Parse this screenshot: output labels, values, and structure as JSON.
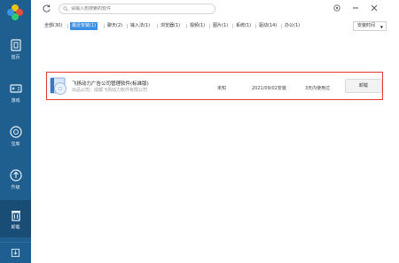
{
  "search": {
    "placeholder": "请输入想搜索的软件"
  },
  "sidebar": {
    "items": [
      {
        "label": "首页"
      },
      {
        "label": "游戏"
      },
      {
        "label": "宝库"
      },
      {
        "label": "升级"
      },
      {
        "label": "卸载"
      }
    ]
  },
  "tabs": [
    {
      "label": "全部(30)"
    },
    {
      "label": "最近安装(1)"
    },
    {
      "label": "聊天(2)"
    },
    {
      "label": "输入法(1)"
    },
    {
      "label": "浏览器(1)"
    },
    {
      "label": "视频(1)"
    },
    {
      "label": "图片(1)"
    },
    {
      "label": "系统(1)"
    },
    {
      "label": "驱动(14)"
    },
    {
      "label": "办公(1)"
    }
  ],
  "sort": {
    "value": "安装时间"
  },
  "software_list": [
    {
      "name": "飞扬动力广告公司管理软件(标准版)",
      "publisher": "出品公司：成都飞扬动力软件有限公司",
      "size": "未知",
      "install_date": "2021/09/02安装",
      "usage": "3天内使用过",
      "action": "卸载"
    }
  ],
  "colors": {
    "sidebar": "#1f5f8f",
    "sidebar_active": "#1a4d76",
    "accent": "#3c8fe0",
    "highlight": "#e53935"
  },
  "icons": [
    "app-logo-icon",
    "refresh-icon",
    "search-icon",
    "settings-icon",
    "minimize-icon",
    "close-icon",
    "home-icon",
    "gamepad-icon",
    "treasure-icon",
    "upgrade-icon",
    "trash-icon",
    "download-icon",
    "cd-box-icon"
  ]
}
